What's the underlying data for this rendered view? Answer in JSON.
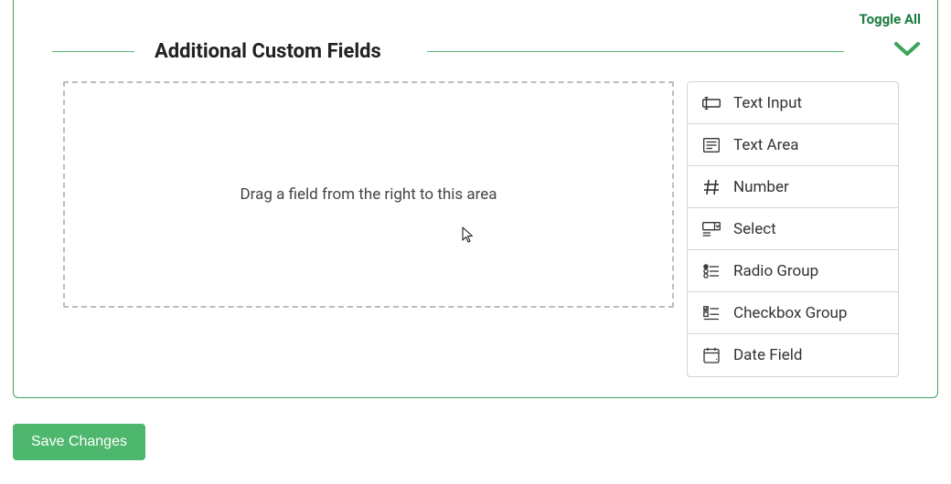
{
  "toggle_all_label": "Toggle All",
  "section_title": "Additional Custom Fields",
  "drop_placeholder": "Drag a field from the right to this area",
  "palette_items": [
    {
      "label": "Text Input"
    },
    {
      "label": "Text Area"
    },
    {
      "label": "Number"
    },
    {
      "label": "Select"
    },
    {
      "label": "Radio Group"
    },
    {
      "label": "Checkbox Group"
    },
    {
      "label": "Date Field"
    }
  ],
  "save_button_label": "Save Changes"
}
